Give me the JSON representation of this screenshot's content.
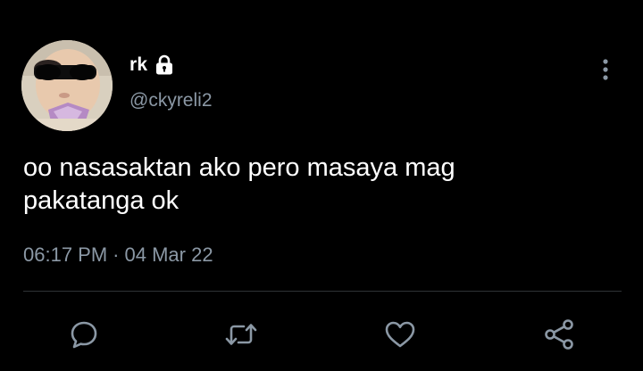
{
  "tweet": {
    "display_name": "rk",
    "handle": "@ckyreli2",
    "text": "oo nasasaktan ako pero masaya mag\npakatanga ok",
    "time": "06:17 PM",
    "separator": "·",
    "date": "04 Mar 22",
    "locked_account": true
  },
  "icons": {
    "lock": "lock-icon",
    "more": "more-vertical-icon",
    "reply": "reply-icon",
    "retweet": "retweet-icon",
    "like": "heart-icon",
    "share": "share-icon"
  },
  "colors": {
    "background": "#000000",
    "primary_text": "#ffffff",
    "secondary_text": "#8b98a5",
    "divider": "#2f3336",
    "icon": "#8b98a5"
  }
}
